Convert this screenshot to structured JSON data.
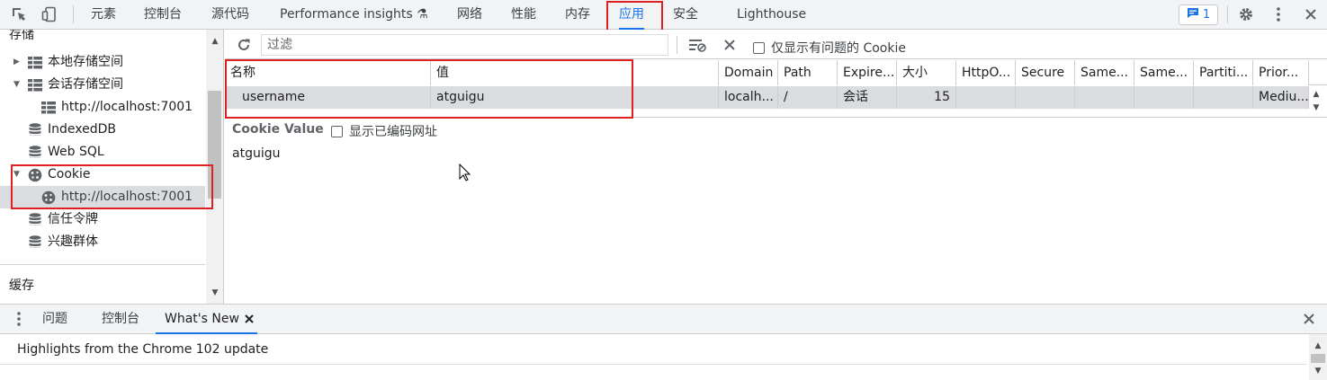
{
  "toolbar": {
    "tabs": [
      {
        "label": "元素"
      },
      {
        "label": "控制台"
      },
      {
        "label": "源代码"
      },
      {
        "label": "Performance insights ⚗"
      },
      {
        "label": "网络"
      },
      {
        "label": "性能"
      },
      {
        "label": "内存"
      },
      {
        "label": "应用"
      },
      {
        "label": "安全"
      },
      {
        "label": "Lighthouse"
      }
    ],
    "active_tab": "应用",
    "issues_count": "1",
    "accent_color": "#1a73e8",
    "highlight_color": "#e02020"
  },
  "sidebar": {
    "section_storage": "存储",
    "items": [
      {
        "label": "本地存储空间",
        "icon": "grid-icon"
      },
      {
        "label": "会话存储空间",
        "icon": "grid-icon"
      },
      {
        "label": "http://localhost:7001",
        "icon": "grid-icon"
      },
      {
        "label": "IndexedDB",
        "icon": "database-icon"
      },
      {
        "label": "Web SQL",
        "icon": "database-icon"
      },
      {
        "label": "Cookie",
        "icon": "cookie-icon"
      },
      {
        "label": "http://localhost:7001",
        "icon": "cookie-icon"
      },
      {
        "label": "信任令牌",
        "icon": "database-icon"
      },
      {
        "label": "兴趣群体",
        "icon": "database-icon"
      }
    ],
    "section_cache": "缓存"
  },
  "main": {
    "filter_placeholder": "过滤",
    "only_issues_label": "仅显示有问题的 Cookie",
    "columns": [
      "名称",
      "值",
      "Domain",
      "Path",
      "Expire...",
      "大小",
      "HttpO...",
      "Secure",
      "Same...",
      "Same...",
      "Partiti...",
      "Prior..."
    ],
    "rows": [
      [
        "username",
        "atguigu",
        "localh...",
        "/",
        "会话",
        "15",
        "",
        "",
        "",
        "",
        "",
        "Mediu..."
      ]
    ],
    "cookie_value_label": "Cookie Value",
    "show_decoded_label": "显示已编码网址",
    "cookie_value": "atguigu"
  },
  "drawer": {
    "tabs": [
      {
        "label": "问题"
      },
      {
        "label": "控制台"
      },
      {
        "label": "What's New"
      }
    ],
    "active_tab": "What's New",
    "headline": "Highlights from the Chrome 102 update"
  }
}
